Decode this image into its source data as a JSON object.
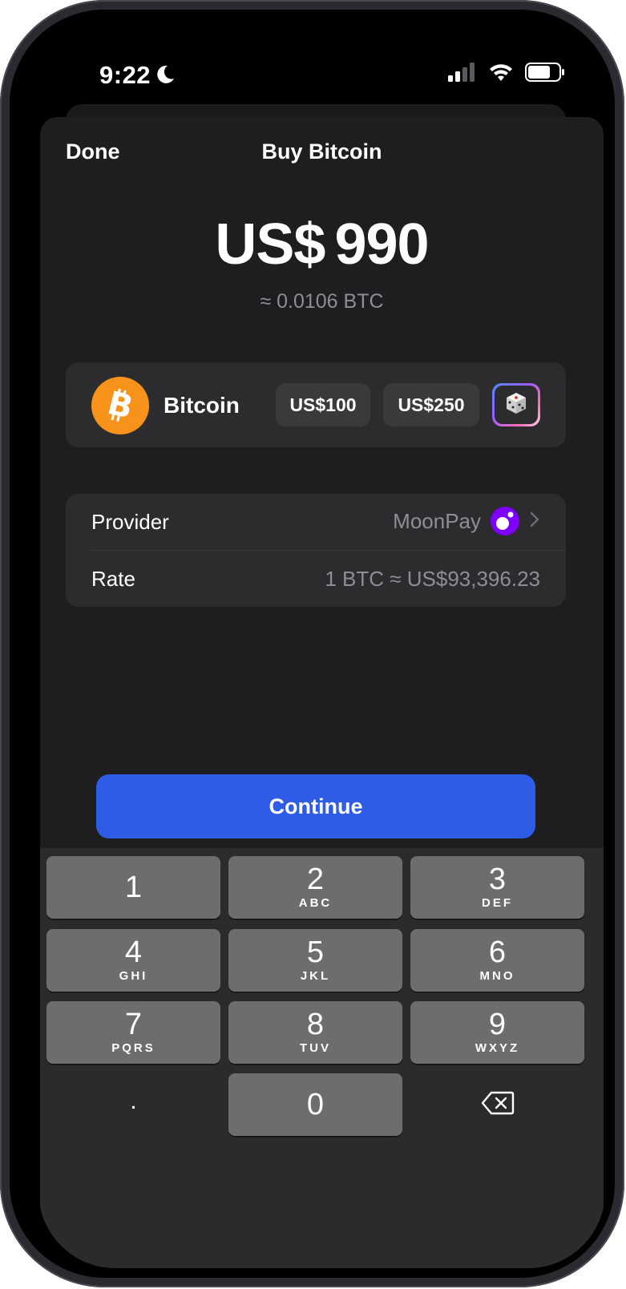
{
  "status_bar": {
    "time": "9:22",
    "icons": [
      "moon-icon",
      "cellular-signal-icon",
      "wifi-icon",
      "battery-icon"
    ]
  },
  "nav": {
    "done_label": "Done",
    "title": "Buy Bitcoin"
  },
  "amount": {
    "currency": "US$",
    "value": "990",
    "approx": "≈ 0.0106 BTC"
  },
  "asset": {
    "name": "Bitcoin",
    "logo_color": "#f7931a",
    "quick_amounts": [
      "US$100",
      "US$250"
    ],
    "random_icon": "dice-icon"
  },
  "details": {
    "provider_label": "Provider",
    "provider_value": "MoonPay",
    "rate_label": "Rate",
    "rate_value": "1 BTC ≈ US$93,396.23"
  },
  "continue_label": "Continue",
  "keypad": {
    "keys": [
      {
        "digit": "1",
        "letters": ""
      },
      {
        "digit": "2",
        "letters": "ABC"
      },
      {
        "digit": "3",
        "letters": "DEF"
      },
      {
        "digit": "4",
        "letters": "GHI"
      },
      {
        "digit": "5",
        "letters": "JKL"
      },
      {
        "digit": "6",
        "letters": "MNO"
      },
      {
        "digit": "7",
        "letters": "PQRS"
      },
      {
        "digit": "8",
        "letters": "TUV"
      },
      {
        "digit": "9",
        "letters": "WXYZ"
      },
      {
        "digit": "0",
        "letters": ""
      }
    ],
    "decimal": ".",
    "delete_icon": "backspace-icon"
  },
  "colors": {
    "accent": "#2e5ce6",
    "background": "#1e1e20",
    "card": "#2c2c2e",
    "secondary_text": "#8e8e93",
    "moonpay": "#7d00ff"
  }
}
